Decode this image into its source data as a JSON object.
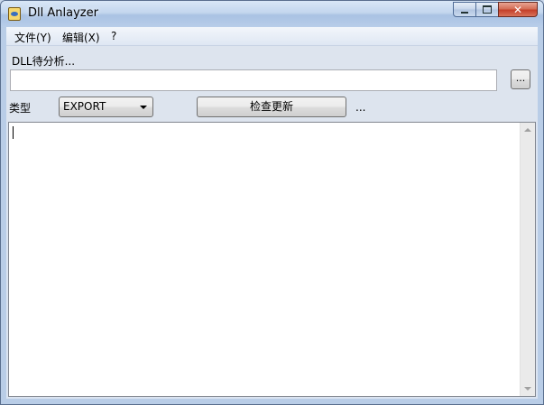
{
  "window": {
    "title": "Dll Anlayzer",
    "icon": "app-icon",
    "controls": {
      "minimize": "minimize-icon",
      "maximize": "maximize-icon",
      "close": "✕"
    }
  },
  "menu": {
    "items": [
      {
        "label": "文件(Y)"
      },
      {
        "label": "编辑(X)"
      },
      {
        "label": "?"
      }
    ]
  },
  "form": {
    "dll_label": "DLL待分析...",
    "path_value": "",
    "browse_label": "...",
    "type_label": "类型",
    "type_selected": "EXPORT",
    "update_button": "检查更新",
    "trailing_label": "..."
  },
  "output": {
    "text": ""
  }
}
